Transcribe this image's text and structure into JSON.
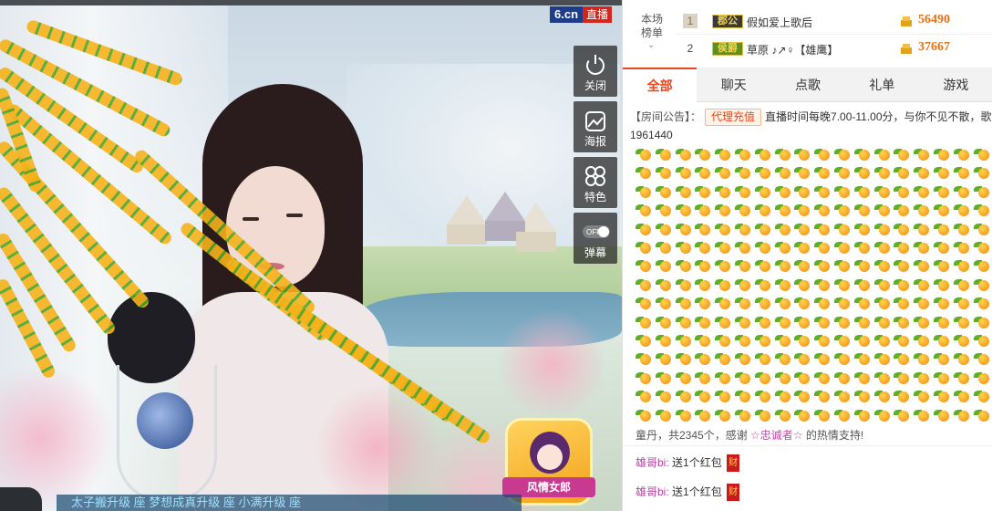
{
  "video": {
    "logo_site": "6.cn",
    "logo_live": "直播",
    "side_buttons": [
      {
        "label": "关闭",
        "icon": "power-icon"
      },
      {
        "label": "海报",
        "icon": "poster-icon"
      },
      {
        "label": "特色",
        "icon": "feature-icon"
      },
      {
        "label": "弹幕",
        "icon": "danmaku-toggle-icon",
        "toggle": "OFF"
      }
    ],
    "badge_text": "风情女郎",
    "danmu_text": "太子搬升级 座  梦想成真升级 座  小满升级 座"
  },
  "rank": {
    "title_line1": "本场",
    "title_line2": "榜单",
    "rows": [
      {
        "num": "1",
        "level": "郡公",
        "name": "假如爱上歌后",
        "score": "56490"
      },
      {
        "num": "2",
        "level": "侯爵",
        "name": "草原 ♪↗♀【雄鹰】",
        "score": "37667"
      }
    ]
  },
  "tabs": [
    "全部",
    "聊天",
    "点歌",
    "礼单",
    "游戏"
  ],
  "notice": {
    "prefix": "【房间公告】：",
    "button": "代理充值",
    "text": "直播时间每晚7.00-11.00分，与你不见不散，歌",
    "second_line": "1961440"
  },
  "gift_grid": {
    "rows": 15,
    "cols": 18,
    "icon": "orange-gift-icon"
  },
  "thanks": {
    "text_before": "童丹，共2345个，感谢",
    "user": "☆忠诚者☆",
    "text_after": "的热情支持!"
  },
  "messages": [
    {
      "user": "雄哥bi:",
      "text": "送1个红包",
      "badge": "财"
    },
    {
      "user": "雄哥bi:",
      "text": "送1个红包",
      "badge": "财"
    }
  ],
  "colors": {
    "accent": "#e8471d",
    "score": "#e2731c",
    "username": "#b6449e"
  }
}
